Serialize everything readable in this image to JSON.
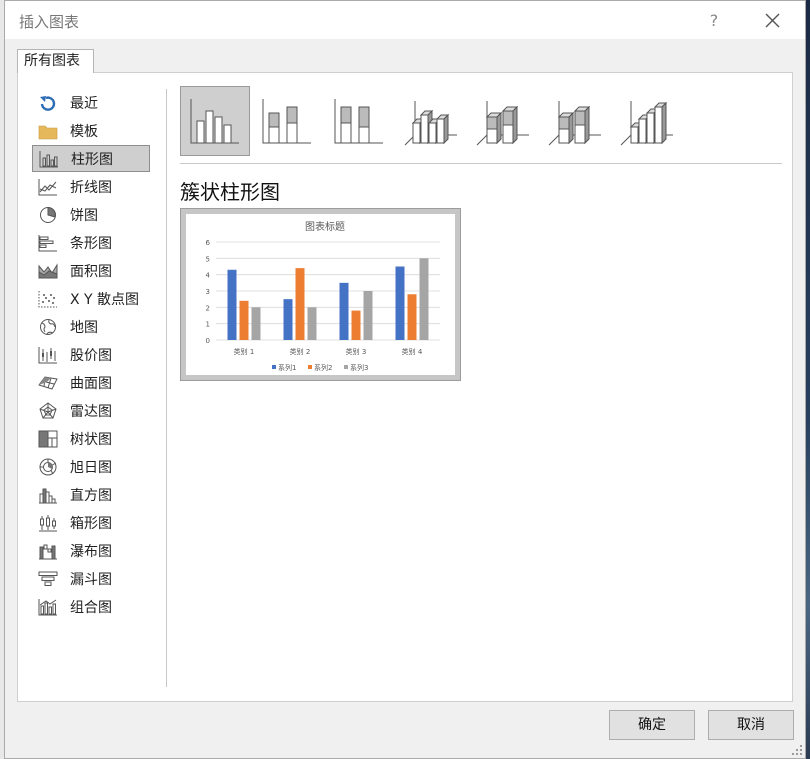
{
  "dialog": {
    "title": "插入图表",
    "help_label": "?"
  },
  "tabs": [
    {
      "label": "所有图表",
      "active": true
    }
  ],
  "sidebar": {
    "selected_index": 2,
    "items": [
      {
        "label": "最近",
        "icon": "recent-icon"
      },
      {
        "label": "模板",
        "icon": "folder-icon"
      },
      {
        "label": "柱形图",
        "icon": "column-chart-icon"
      },
      {
        "label": "折线图",
        "icon": "line-chart-icon"
      },
      {
        "label": "饼图",
        "icon": "pie-chart-icon"
      },
      {
        "label": "条形图",
        "icon": "bar-chart-icon"
      },
      {
        "label": "面积图",
        "icon": "area-chart-icon"
      },
      {
        "label": "X Y 散点图",
        "icon": "scatter-chart-icon"
      },
      {
        "label": "地图",
        "icon": "map-chart-icon"
      },
      {
        "label": "股价图",
        "icon": "stock-chart-icon"
      },
      {
        "label": "曲面图",
        "icon": "surface-chart-icon"
      },
      {
        "label": "雷达图",
        "icon": "radar-chart-icon"
      },
      {
        "label": "树状图",
        "icon": "treemap-chart-icon"
      },
      {
        "label": "旭日图",
        "icon": "sunburst-chart-icon"
      },
      {
        "label": "直方图",
        "icon": "histogram-chart-icon"
      },
      {
        "label": "箱形图",
        "icon": "box-whisker-chart-icon"
      },
      {
        "label": "瀑布图",
        "icon": "waterfall-chart-icon"
      },
      {
        "label": "漏斗图",
        "icon": "funnel-chart-icon"
      },
      {
        "label": "组合图",
        "icon": "combo-chart-icon"
      }
    ]
  },
  "subtypes": {
    "selected_index": 0,
    "items": [
      {
        "icon": "clustered-column-icon"
      },
      {
        "icon": "stacked-column-icon"
      },
      {
        "icon": "percent-stacked-column-icon"
      },
      {
        "icon": "3d-clustered-column-icon"
      },
      {
        "icon": "3d-stacked-column-icon"
      },
      {
        "icon": "3d-percent-stacked-column-icon"
      },
      {
        "icon": "3d-column-icon"
      }
    ]
  },
  "selected_chart_name": "簇状柱形图",
  "chart_data": {
    "type": "bar",
    "title": "图表标题",
    "categories": [
      "类别 1",
      "类别 2",
      "类别 3",
      "类别 4"
    ],
    "series": [
      {
        "name": "系列1",
        "values": [
          4.3,
          2.5,
          3.5,
          4.5
        ],
        "color": "#4472c4"
      },
      {
        "name": "系列2",
        "values": [
          2.4,
          4.4,
          1.8,
          2.8
        ],
        "color": "#ed7d31"
      },
      {
        "name": "系列3",
        "values": [
          2,
          2,
          3,
          5
        ],
        "color": "#a5a5a5"
      }
    ],
    "ylim": [
      0,
      6
    ],
    "yticks": [
      "0",
      "1",
      "2",
      "3",
      "4",
      "5",
      "6"
    ],
    "grid": true,
    "legend": "bottom"
  },
  "buttons": {
    "ok": "确定",
    "cancel": "取消"
  },
  "colors": {
    "selection_bg": "#cfcfcf",
    "recent_icon": "#2e6db4",
    "folder_icon": "#e6b85c"
  }
}
